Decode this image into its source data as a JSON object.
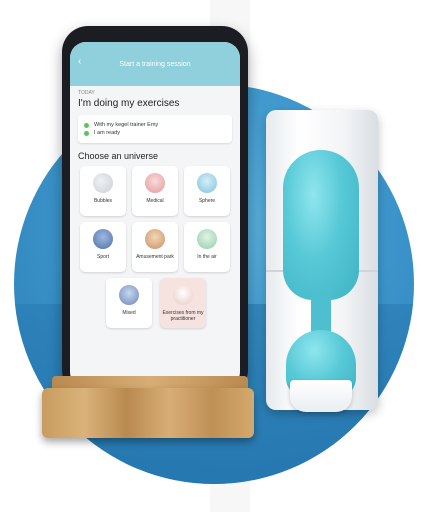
{
  "screen": {
    "title": "Start a training session",
    "today": "TODAY",
    "heading": "I'm doing my exercises",
    "checklist": [
      "With my kegel trainer Emy",
      "I am ready"
    ],
    "section_title": "Choose an universe",
    "universes": [
      {
        "label": "Bubbles"
      },
      {
        "label": "Medical"
      },
      {
        "label": "Sphere"
      },
      {
        "label": "Sport"
      },
      {
        "label": "Amusement park"
      },
      {
        "label": "In the air"
      },
      {
        "label": "Mixed"
      },
      {
        "label": "Exercises from my practitioner"
      }
    ]
  },
  "colors": {
    "topbar": "#8fd0dc",
    "circle": "#3f98cd",
    "device": "#56c8d6",
    "check_dot": "#5cc15f"
  }
}
